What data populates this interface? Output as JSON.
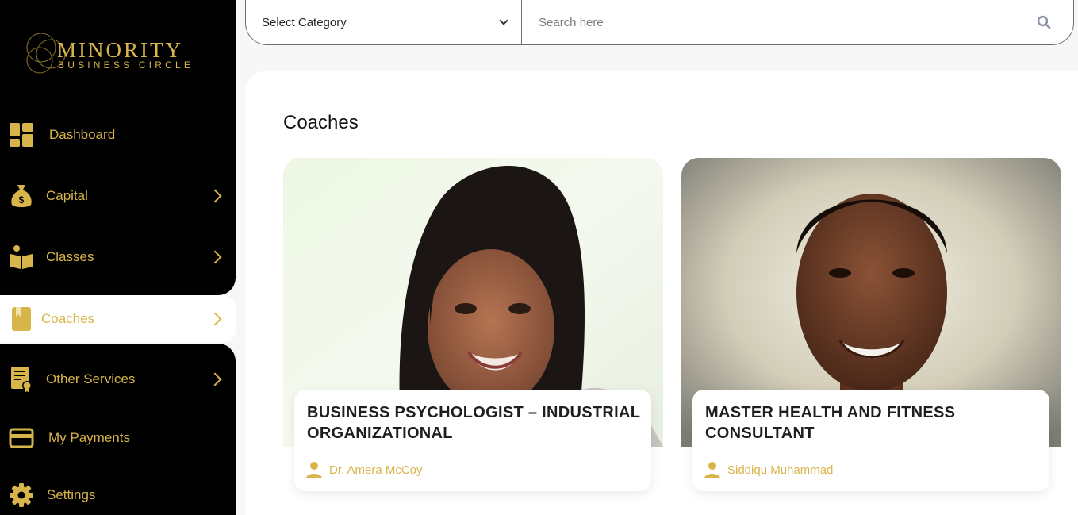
{
  "brand": {
    "line1": "MINORITY",
    "line2": "BUSINESS CIRCLE"
  },
  "colors": {
    "accent": "#d8b54a",
    "sidebar_bg": "#000000",
    "page_bg": "#f7f7f8"
  },
  "sidebar": {
    "items": [
      {
        "label": "Dashboard",
        "icon": "dashboard-grid-icon",
        "has_submenu": false,
        "active": false
      },
      {
        "label": "Capital",
        "icon": "money-bag-icon",
        "has_submenu": true,
        "active": false
      },
      {
        "label": "Classes",
        "icon": "open-book-icon",
        "has_submenu": true,
        "active": false
      },
      {
        "label": "Coaches",
        "icon": "bookmark-book-icon",
        "has_submenu": true,
        "active": true
      },
      {
        "label": "Other Services",
        "icon": "certificate-icon",
        "has_submenu": true,
        "active": false
      },
      {
        "label": "My Payments",
        "icon": "credit-card-icon",
        "has_submenu": false,
        "active": false
      },
      {
        "label": "Settings",
        "icon": "gear-icon",
        "has_submenu": false,
        "active": false
      }
    ]
  },
  "topbar": {
    "category_select": {
      "value": "Select Category"
    },
    "search": {
      "placeholder": "Search here",
      "value": ""
    }
  },
  "main": {
    "title": "Coaches",
    "coaches": [
      {
        "title": "BUSINESS PSYCHOLOGIST – INDUSTRIAL ORGANIZATIONAL",
        "name": "Dr. Amera McCoy"
      },
      {
        "title": "MASTER HEALTH AND FITNESS CONSULTANT",
        "name": "Siddiqu Muhammad"
      }
    ]
  }
}
